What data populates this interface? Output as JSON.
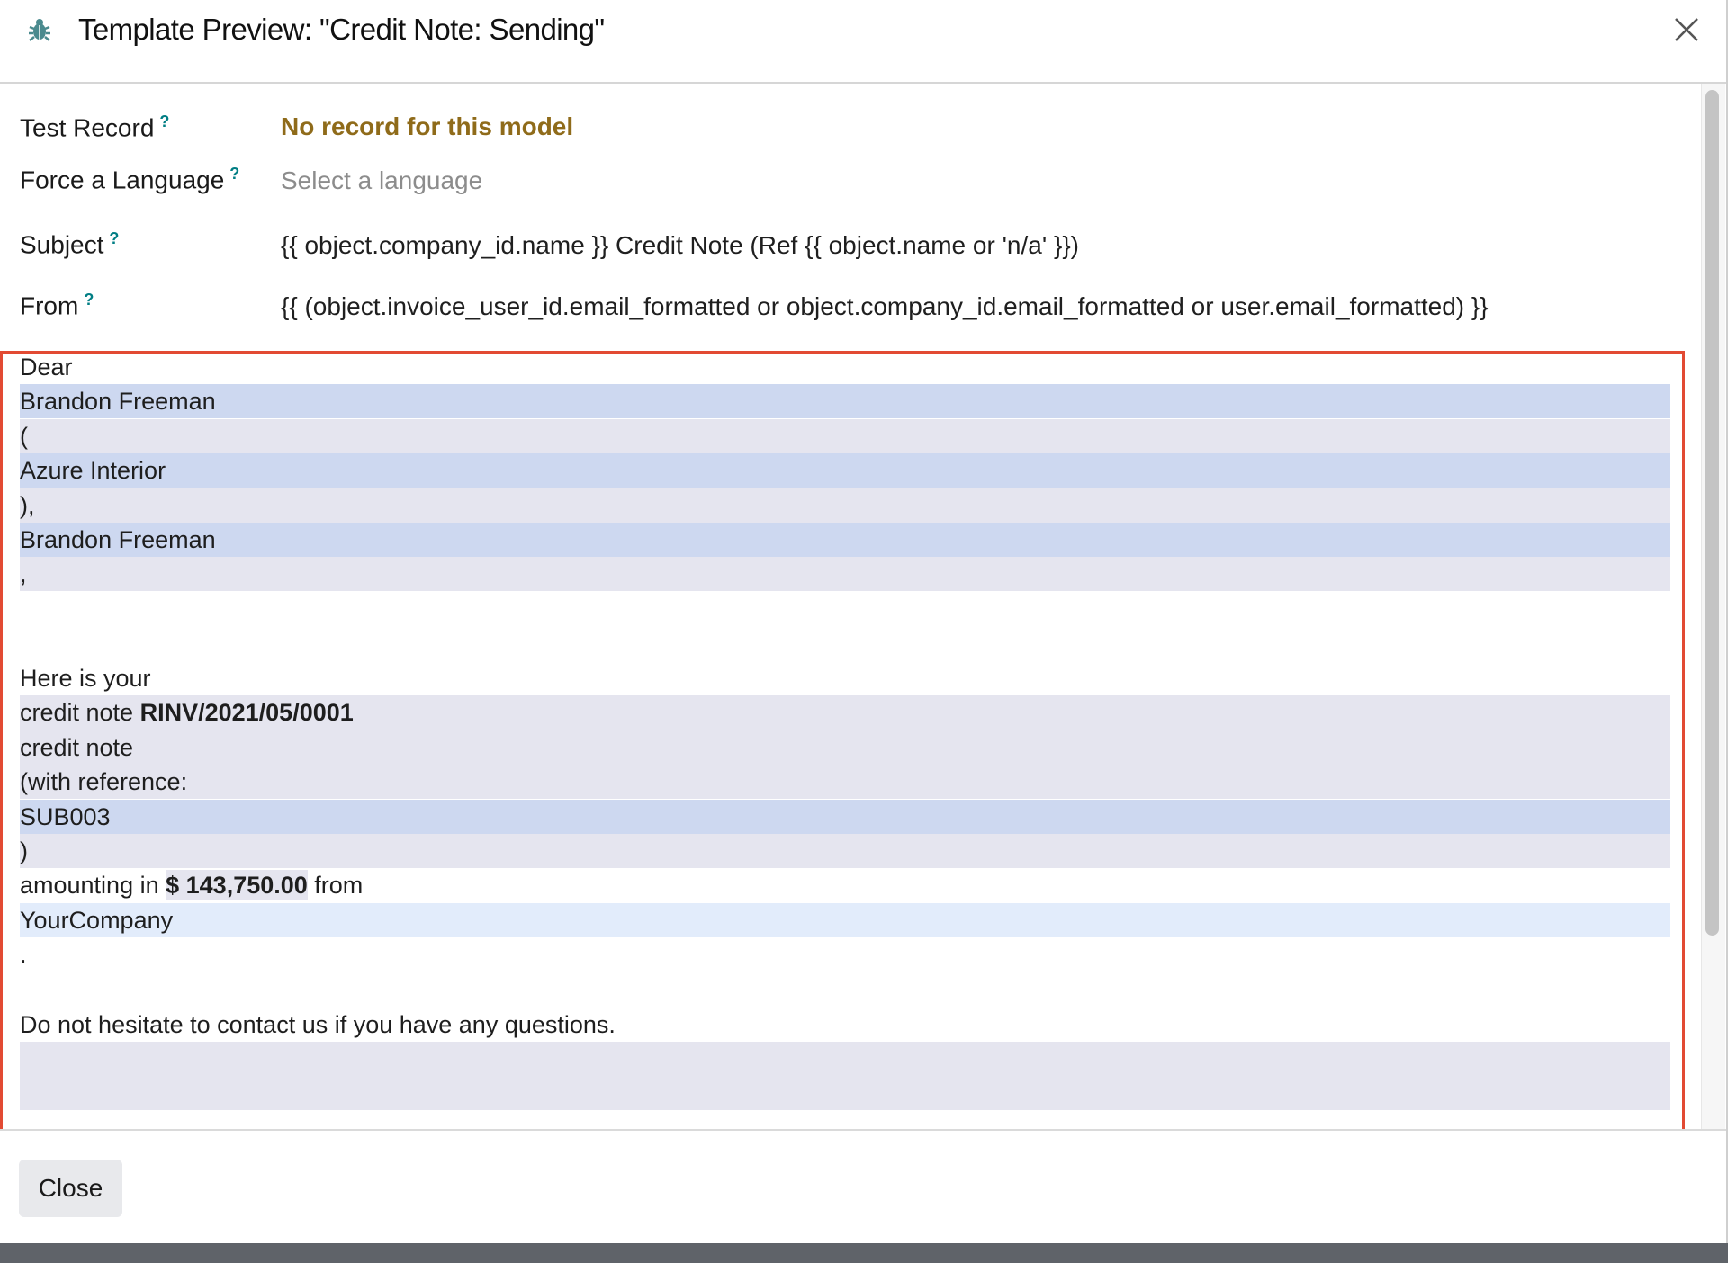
{
  "header": {
    "title": "Template Preview: \"Credit Note: Sending\"",
    "icon": "bug-icon",
    "close_icon": "close-icon"
  },
  "fields": {
    "test_record": {
      "label": "Test Record",
      "help": "?",
      "value": "No record for this model"
    },
    "force_language": {
      "label": "Force a Language",
      "help": "?",
      "placeholder": "Select a language"
    },
    "subject": {
      "label": "Subject",
      "help": "?",
      "value": "{{ object.company_id.name }} Credit Note (Ref {{ object.name or 'n/a' }})"
    },
    "from": {
      "label": "From",
      "help": "?",
      "value": "{{ (object.invoice_user_id.email_formatted or object.company_id.email_formatted or user.email_formatted) }}"
    }
  },
  "preview": {
    "dear": "Dear",
    "partner_name": "Brandon Freeman",
    "open_paren": "(",
    "company_name": "Azure Interior",
    "close_paren_comma": "),",
    "partner_name_2": "Brandon Freeman",
    "comma": ",",
    "here_is_your": "Here is your",
    "credit_note_prefix": "credit note",
    "credit_note_number": "RINV/2021/05/0001",
    "credit_note_2": "credit note",
    "with_reference": "(with reference:",
    "reference": "SUB003",
    "close_paren": ")",
    "amounting_in": "amounting in",
    "amount": "$ 143,750.00",
    "from_word": "from",
    "your_company": "YourCompany",
    "period": ".",
    "closing_line": "Do not hesitate to contact us if you have any questions."
  },
  "footer": {
    "close_label": "Close"
  },
  "colors": {
    "warning_text": "#8f6b1a",
    "help_mark": "#017e84",
    "highlight_blue": "#cdd8f0",
    "highlight_grey": "#e5e5ef",
    "highlight_light": "#e2ecfb",
    "annotation_red": "#e24a33"
  }
}
